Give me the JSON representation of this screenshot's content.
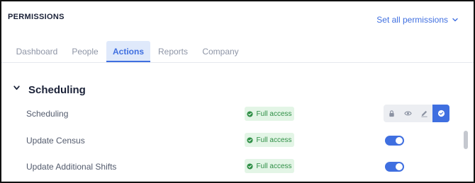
{
  "header": {
    "title": "PERMISSIONS",
    "set_all_label": "Set all permissions"
  },
  "tabs": [
    {
      "label": "Dashboard",
      "active": false
    },
    {
      "label": "People",
      "active": false
    },
    {
      "label": "Actions",
      "active": true
    },
    {
      "label": "Reports",
      "active": false
    },
    {
      "label": "Company",
      "active": false
    }
  ],
  "section": {
    "title": "Scheduling",
    "expanded": true
  },
  "rows": [
    {
      "label": "Scheduling",
      "access": "Full access",
      "control": "permission-buttons",
      "selected": "check"
    },
    {
      "label": "Update Census",
      "access": "Full access",
      "control": "toggle",
      "enabled": true
    },
    {
      "label": "Update Additional Shifts",
      "access": "Full access",
      "control": "toggle",
      "enabled": true
    }
  ],
  "permission_buttons": [
    "lock-icon",
    "eye-icon",
    "pencil-icon",
    "check-circle-icon"
  ],
  "colors": {
    "accent": "#3f6fe0",
    "badge_bg": "#e3f5e6",
    "badge_text": "#2f8f46",
    "tab_active_bg": "#dfe9fb"
  }
}
